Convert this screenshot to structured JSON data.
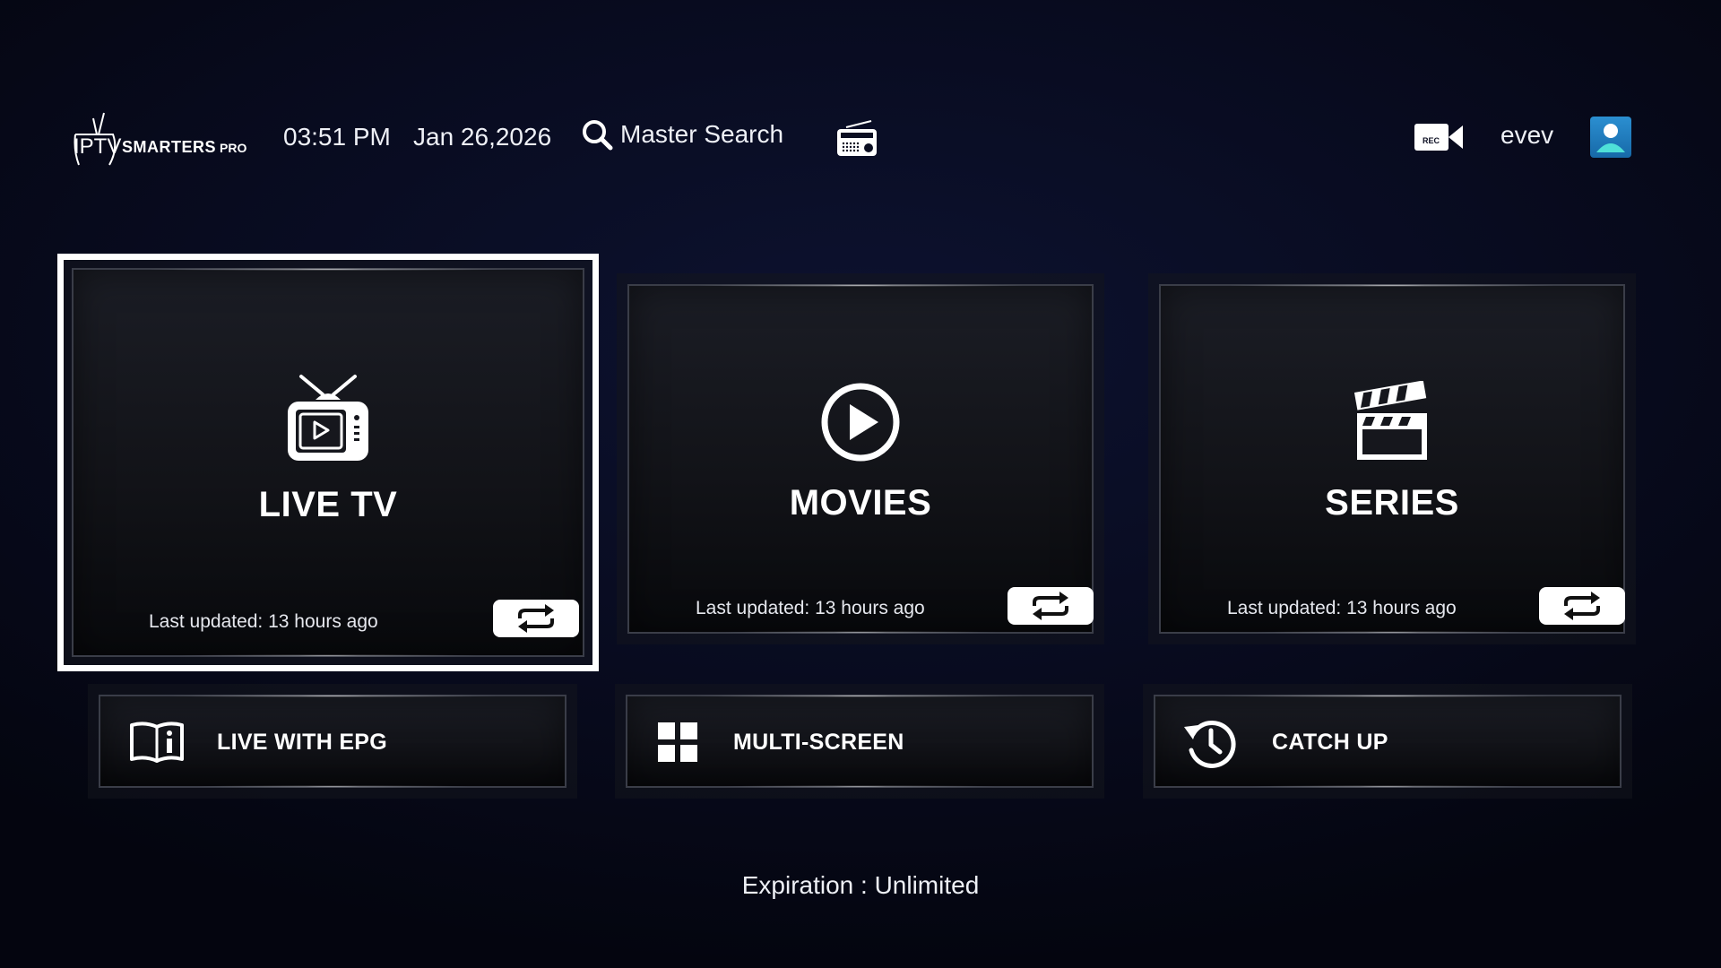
{
  "header": {
    "logo_iptv": "IPTV",
    "logo_brand": "SMARTERS",
    "logo_pro": "PRO",
    "time": "03:51 PM",
    "date": "Jan 26,2026",
    "search_label": "Master Search",
    "rec_badge": "REC",
    "username": "evev"
  },
  "tiles": {
    "live_tv": {
      "title": "LIVE TV",
      "last_updated": "Last updated: 13 hours ago",
      "icon": "tv-icon"
    },
    "movies": {
      "title": "MOVIES",
      "last_updated": "Last updated: 13 hours ago",
      "icon": "play-circle-icon"
    },
    "series": {
      "title": "SERIES",
      "last_updated": "Last updated: 13 hours ago",
      "icon": "clapperboard-icon"
    }
  },
  "small_tiles": {
    "live_epg": {
      "title": "LIVE WITH EPG",
      "icon": "book-info-icon"
    },
    "multi_screen": {
      "title": "MULTI-SCREEN",
      "icon": "grid-icon"
    },
    "catch_up": {
      "title": "CATCH UP",
      "icon": "history-icon"
    }
  },
  "footer": {
    "expiration": "Expiration : Unlimited"
  },
  "colors": {
    "background": "#080b1f",
    "focus_outline": "#ffffff",
    "avatar": "#1f7fbf"
  }
}
